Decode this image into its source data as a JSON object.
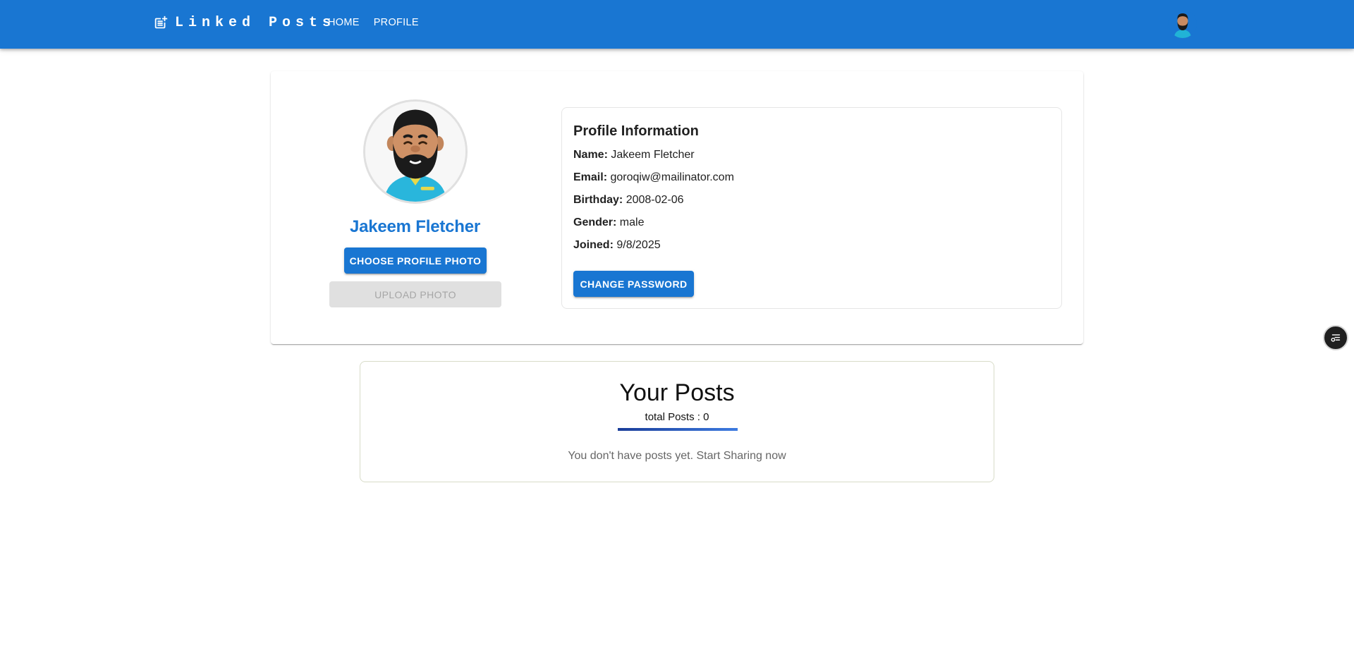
{
  "header": {
    "brand": "Linked Posts",
    "brand_icon": "post-add-icon",
    "nav": [
      {
        "label": "HOME"
      },
      {
        "label": "PROFILE"
      }
    ],
    "avatar_icon": "user-avatar"
  },
  "profile": {
    "name": "Jakeem Fletcher",
    "choose_photo_label": "CHOOSE PROFILE PHOTO",
    "upload_photo_label": "UPLOAD PHOTO",
    "info": {
      "title": "Profile Information",
      "name_label": "Name:",
      "name_value": "Jakeem Fletcher",
      "email_label": "Email:",
      "email_value": "goroqiw@mailinator.com",
      "birthday_label": "Birthday:",
      "birthday_value": "2008-02-06",
      "gender_label": "Gender:",
      "gender_value": "male",
      "joined_label": "Joined:",
      "joined_value": "9/8/2025"
    },
    "change_password_label": "CHANGE PASSWORD"
  },
  "posts": {
    "title": "Your Posts",
    "total": "total Posts : 0",
    "empty_message": "You don't have posts yet. Start Sharing now"
  },
  "colors": {
    "primary": "#1976d2",
    "disabled_bg": "#e0e0e0"
  },
  "floating_button_icon": "toolbar-toggle-icon"
}
